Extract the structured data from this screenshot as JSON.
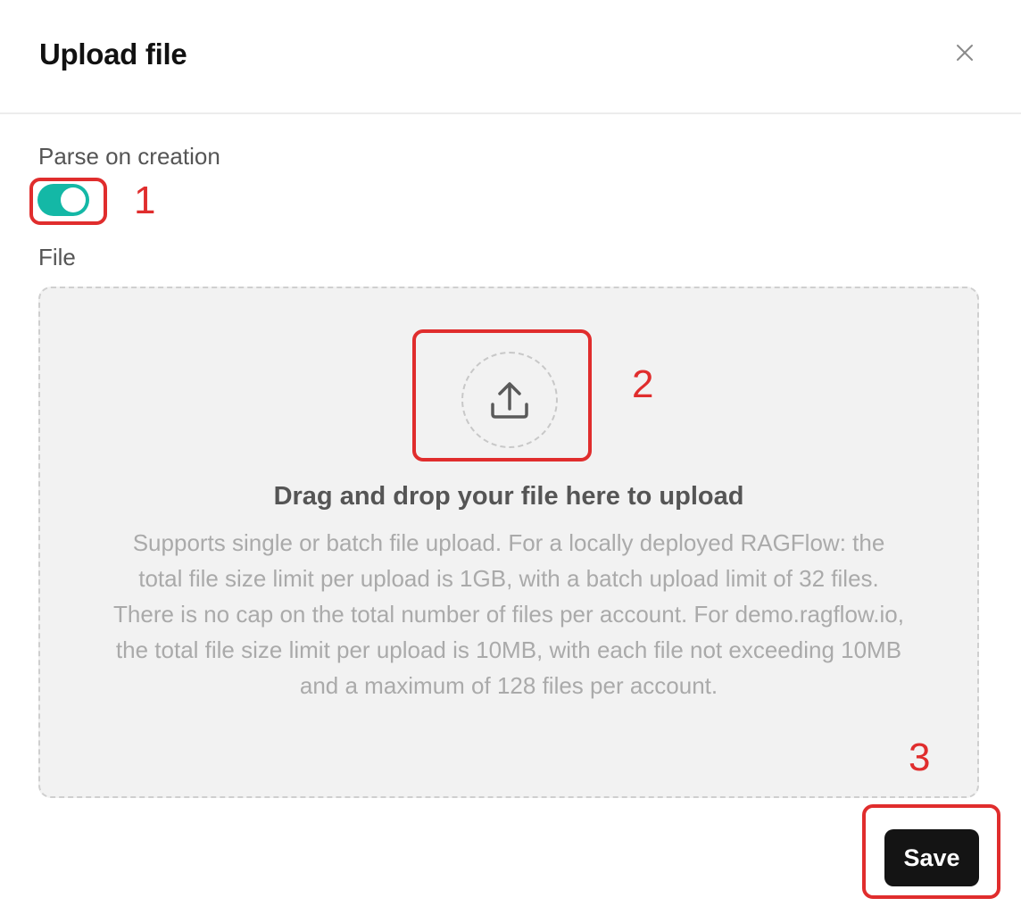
{
  "dialog": {
    "title": "Upload file",
    "close_icon": "close-icon"
  },
  "parse_on_creation": {
    "label": "Parse on creation",
    "enabled": true,
    "accent_color": "#14b8a6"
  },
  "file": {
    "label": "File",
    "dropzone": {
      "icon": "upload-icon",
      "title": "Drag and drop your file here to upload",
      "description": "Supports single or batch file upload. For a locally deployed RAGFlow: the total file size limit per upload is 1GB, with a batch upload limit of 32 files. There is no cap on the total number of files per account. For demo.ragflow.io, the total file size limit per upload is 10MB, with each file not exceeding 10MB and a maximum of 128 files per account."
    }
  },
  "footer": {
    "save_label": "Save"
  },
  "annotations": {
    "color": "#e02d2d",
    "labels": [
      "1",
      "2",
      "3"
    ]
  }
}
